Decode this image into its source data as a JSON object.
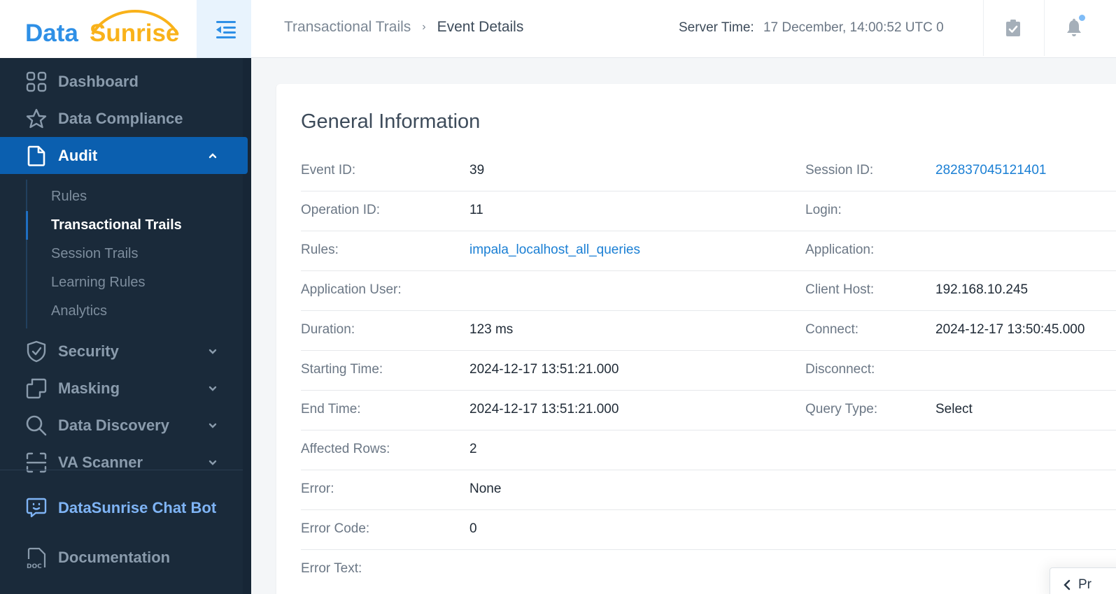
{
  "brand": {
    "name_part1": "Data",
    "name_part2": "Sunrise",
    "colors": {
      "blue": "#2e8fe6",
      "orange": "#f9b21a",
      "sidebar_bg": "#1a2a3a",
      "active_bg": "#0b5faf",
      "link": "#1a7fd4"
    }
  },
  "header": {
    "breadcrumb": [
      {
        "label": "Transactional Trails"
      },
      {
        "label": "Event Details"
      }
    ],
    "breadcrumb_separator": "›",
    "server_time_label": "Server Time:",
    "server_time_value": "17 December, 14:00:52  UTC 0",
    "icons": [
      "clipboard-check-icon",
      "bell-icon"
    ],
    "has_notification": true
  },
  "sidebar": {
    "collapse_icon": "collapse-menu-icon",
    "items": [
      {
        "label": "Dashboard",
        "icon": "dashboard-icon"
      },
      {
        "label": "Data Compliance",
        "icon": "star-icon"
      },
      {
        "label": "Audit",
        "icon": "document-icon",
        "active": true,
        "expanded": true,
        "children": [
          {
            "label": "Rules"
          },
          {
            "label": "Transactional Trails",
            "active": true
          },
          {
            "label": "Session Trails"
          },
          {
            "label": "Learning Rules"
          },
          {
            "label": "Analytics"
          }
        ]
      },
      {
        "label": "Security",
        "icon": "shield-check-icon"
      },
      {
        "label": "Masking",
        "icon": "masking-icon"
      },
      {
        "label": "Data Discovery",
        "icon": "search-icon"
      },
      {
        "label": "VA Scanner",
        "icon": "scanner-icon"
      }
    ],
    "bottom_items": [
      {
        "label": "DataSunrise Chat Bot",
        "icon": "chat-bot-icon"
      },
      {
        "label": "Documentation",
        "icon": "doc-icon"
      }
    ]
  },
  "card": {
    "title": "General Information",
    "rows": [
      {
        "left_label": "Event ID:",
        "left_value": "39",
        "right_label": "Session ID:",
        "right_value": "282837045121401"
      },
      {
        "left_label": "Operation ID:",
        "left_value": "11",
        "right_label": "Login:",
        "right_value": ""
      },
      {
        "left_label": "Rules:",
        "left_value": "impala_localhost_all_queries",
        "right_label": "Application:",
        "right_value": ""
      },
      {
        "left_label": "Application User:",
        "left_value": "",
        "right_label": "Client Host:",
        "right_value": "192.168.10.245"
      },
      {
        "left_label": "Duration:",
        "left_value": "123 ms",
        "right_label": "Connect:",
        "right_value": "2024-12-17 13:50:45.000"
      },
      {
        "left_label": "Starting Time:",
        "left_value": "2024-12-17 13:51:21.000",
        "right_label": "Disconnect:",
        "right_value": ""
      },
      {
        "left_label": "End Time:",
        "left_value": "2024-12-17 13:51:21.000",
        "right_label": "Query Type:",
        "right_value": "Select"
      },
      {
        "left_label": "Affected Rows:",
        "left_value": "2",
        "right_label": "",
        "right_value": ""
      },
      {
        "left_label": "Error:",
        "left_value": "None",
        "right_label": "",
        "right_value": ""
      },
      {
        "left_label": "Error Code:",
        "left_value": "0",
        "right_label": "",
        "right_value": ""
      },
      {
        "left_label": "Error Text:",
        "left_value": "",
        "right_label": "",
        "right_value": ""
      }
    ]
  },
  "floating_button": {
    "label": "Pr",
    "icon": "chevron-left-icon"
  }
}
